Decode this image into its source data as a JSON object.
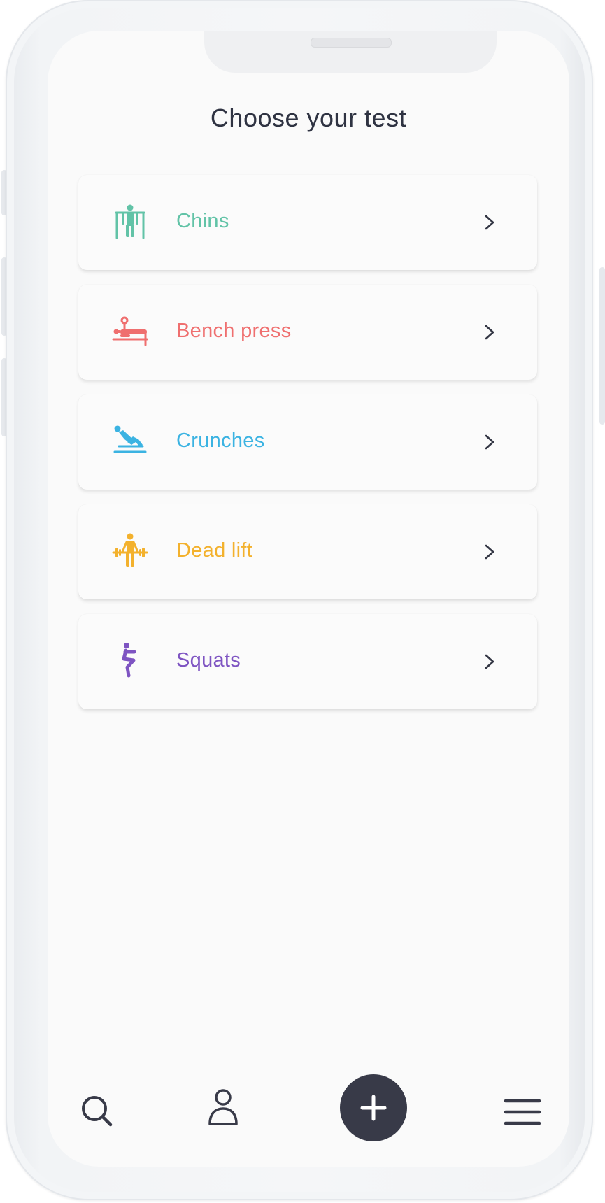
{
  "screen": {
    "title": "Choose your test"
  },
  "tests": [
    {
      "label": "Chins",
      "icon": "pull-up-icon",
      "color": "#62c3a7"
    },
    {
      "label": "Bench press",
      "icon": "bench-press-icon",
      "color": "#ef6f6f"
    },
    {
      "label": "Crunches",
      "icon": "sit-up-icon",
      "color": "#3bb3e2"
    },
    {
      "label": "Dead lift",
      "icon": "deadlift-icon",
      "color": "#f3b12d"
    },
    {
      "label": "Squats",
      "icon": "squat-icon",
      "color": "#7e54c2"
    }
  ],
  "bottom_nav": {
    "items": [
      {
        "icon": "search-icon"
      },
      {
        "icon": "user-icon"
      },
      {
        "icon": "plus-icon",
        "background": "#383a48"
      },
      {
        "icon": "hamburger-menu-icon"
      }
    ]
  },
  "colors": {
    "text_dark": "#2f3342",
    "chevron": "#333644",
    "screen_bg": "#fafafa"
  }
}
